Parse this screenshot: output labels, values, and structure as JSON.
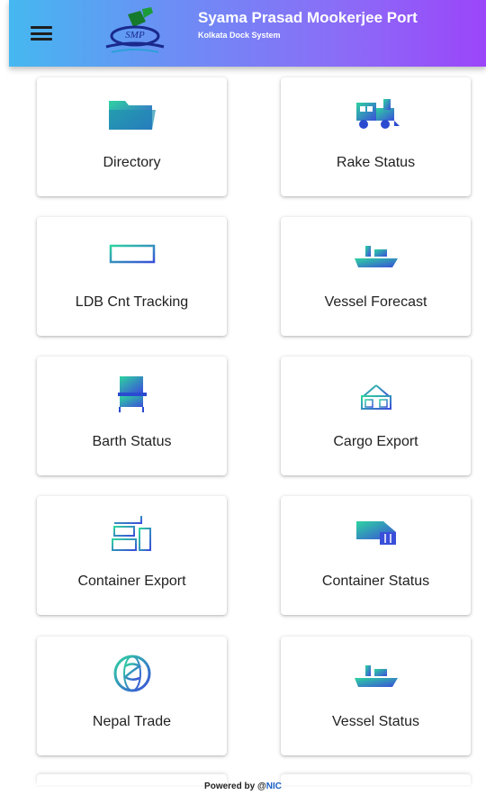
{
  "header": {
    "title": "Syama Prasad Mookerjee Port",
    "subtitle": "Kolkata Dock System",
    "logo_text": "SMP",
    "menu_icon": "hamburger-menu-icon"
  },
  "tiles": [
    {
      "label": "Directory",
      "icon": "folder-icon"
    },
    {
      "label": "Rake Status",
      "icon": "train-icon"
    },
    {
      "label": "LDB Cnt Tracking",
      "icon": "container-icon"
    },
    {
      "label": "Vessel Forecast",
      "icon": "ship-icon"
    },
    {
      "label": "Barth Status",
      "icon": "berth-icon"
    },
    {
      "label": "Cargo Export",
      "icon": "cargo-crane-icon"
    },
    {
      "label": "Container Export",
      "icon": "container-crane-icon"
    },
    {
      "label": "Container Status",
      "icon": "container-truck-icon"
    },
    {
      "label": "Nepal Trade",
      "icon": "globe-icon"
    },
    {
      "label": "Vessel Status",
      "icon": "ship-icon"
    }
  ],
  "footer": {
    "powered_by": "Powered by @",
    "nic": "NIC"
  },
  "colors": {
    "header_start": "#45b8f0",
    "header_end": "#9b45f9",
    "icon_start": "#2fc9a8",
    "icon_end": "#3a5fd9"
  }
}
